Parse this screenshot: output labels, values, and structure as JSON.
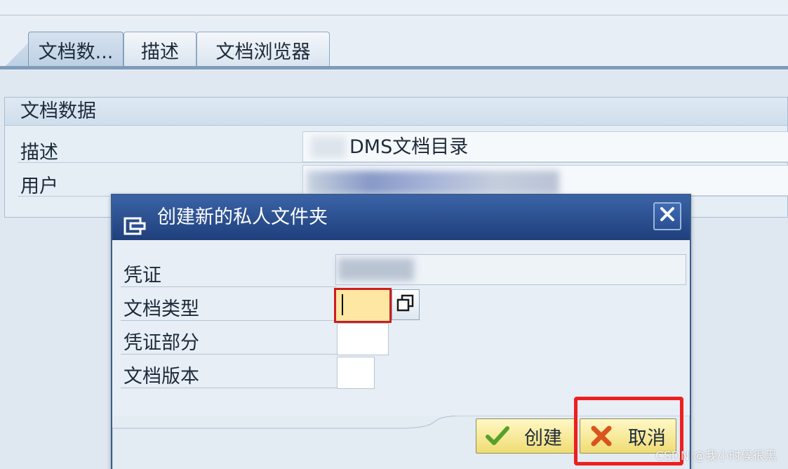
{
  "tabs": [
    {
      "label": "文档数..."
    },
    {
      "label": "描述"
    },
    {
      "label": "文档浏览器"
    }
  ],
  "group": {
    "title": "文档数据",
    "rows": [
      {
        "label": "描述",
        "value": "DMS文档目录"
      },
      {
        "label": "用户",
        "value": ""
      }
    ]
  },
  "dialog": {
    "title": "创建新的私人文件夹",
    "icon": "folder-dialog-icon",
    "fields": [
      {
        "label": "凭证",
        "value": ""
      },
      {
        "label": "文档类型",
        "value": ""
      },
      {
        "label": "凭证部分",
        "value": ""
      },
      {
        "label": "文档版本",
        "value": ""
      }
    ],
    "buttons": {
      "create": "创建",
      "cancel": "取消"
    }
  },
  "watermark": "CSDN @我小时候很黑",
  "colors": {
    "title_bar": "#2a4f93",
    "highlight": "#ee1f1f",
    "focus_field": "#fde7a2",
    "button_bg": "#f0dc73"
  }
}
